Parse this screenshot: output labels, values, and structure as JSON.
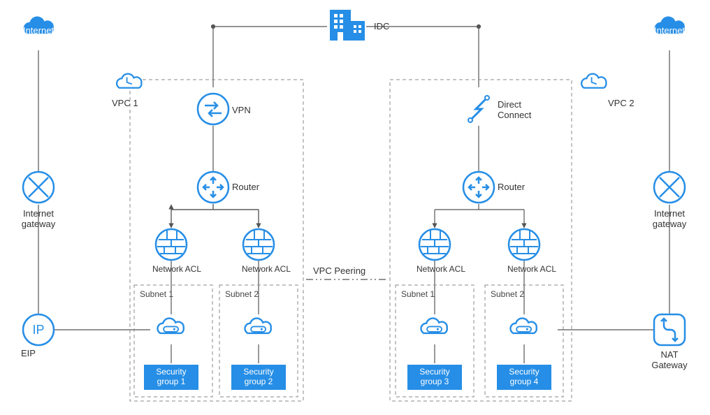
{
  "labels": {
    "internet_left": "Internet",
    "internet_right": "Internet",
    "idc": "IDC",
    "vpc1": "VPC 1",
    "vpc2": "VPC 2",
    "vpn": "VPN",
    "direct_connect": "Direct\nConnect",
    "router_left": "Router",
    "router_right": "Router",
    "nacl": "Network ACL",
    "internet_gateway": "Internet\ngateway",
    "vpc_peering": "VPC Peering",
    "eip": "EIP",
    "ip": "IP",
    "nat_gateway": "NAT\nGateway",
    "subnet1": "Subnet 1",
    "subnet2": "Subnet 2",
    "sg1": "Security\ngroup 1",
    "sg2": "Security\ngroup 2",
    "sg3": "Security\ngroup 3",
    "sg4": "Security\ngroup 4"
  },
  "colors": {
    "primary": "#268ee6",
    "lighter": "#5aa9ec",
    "line": "#555"
  }
}
